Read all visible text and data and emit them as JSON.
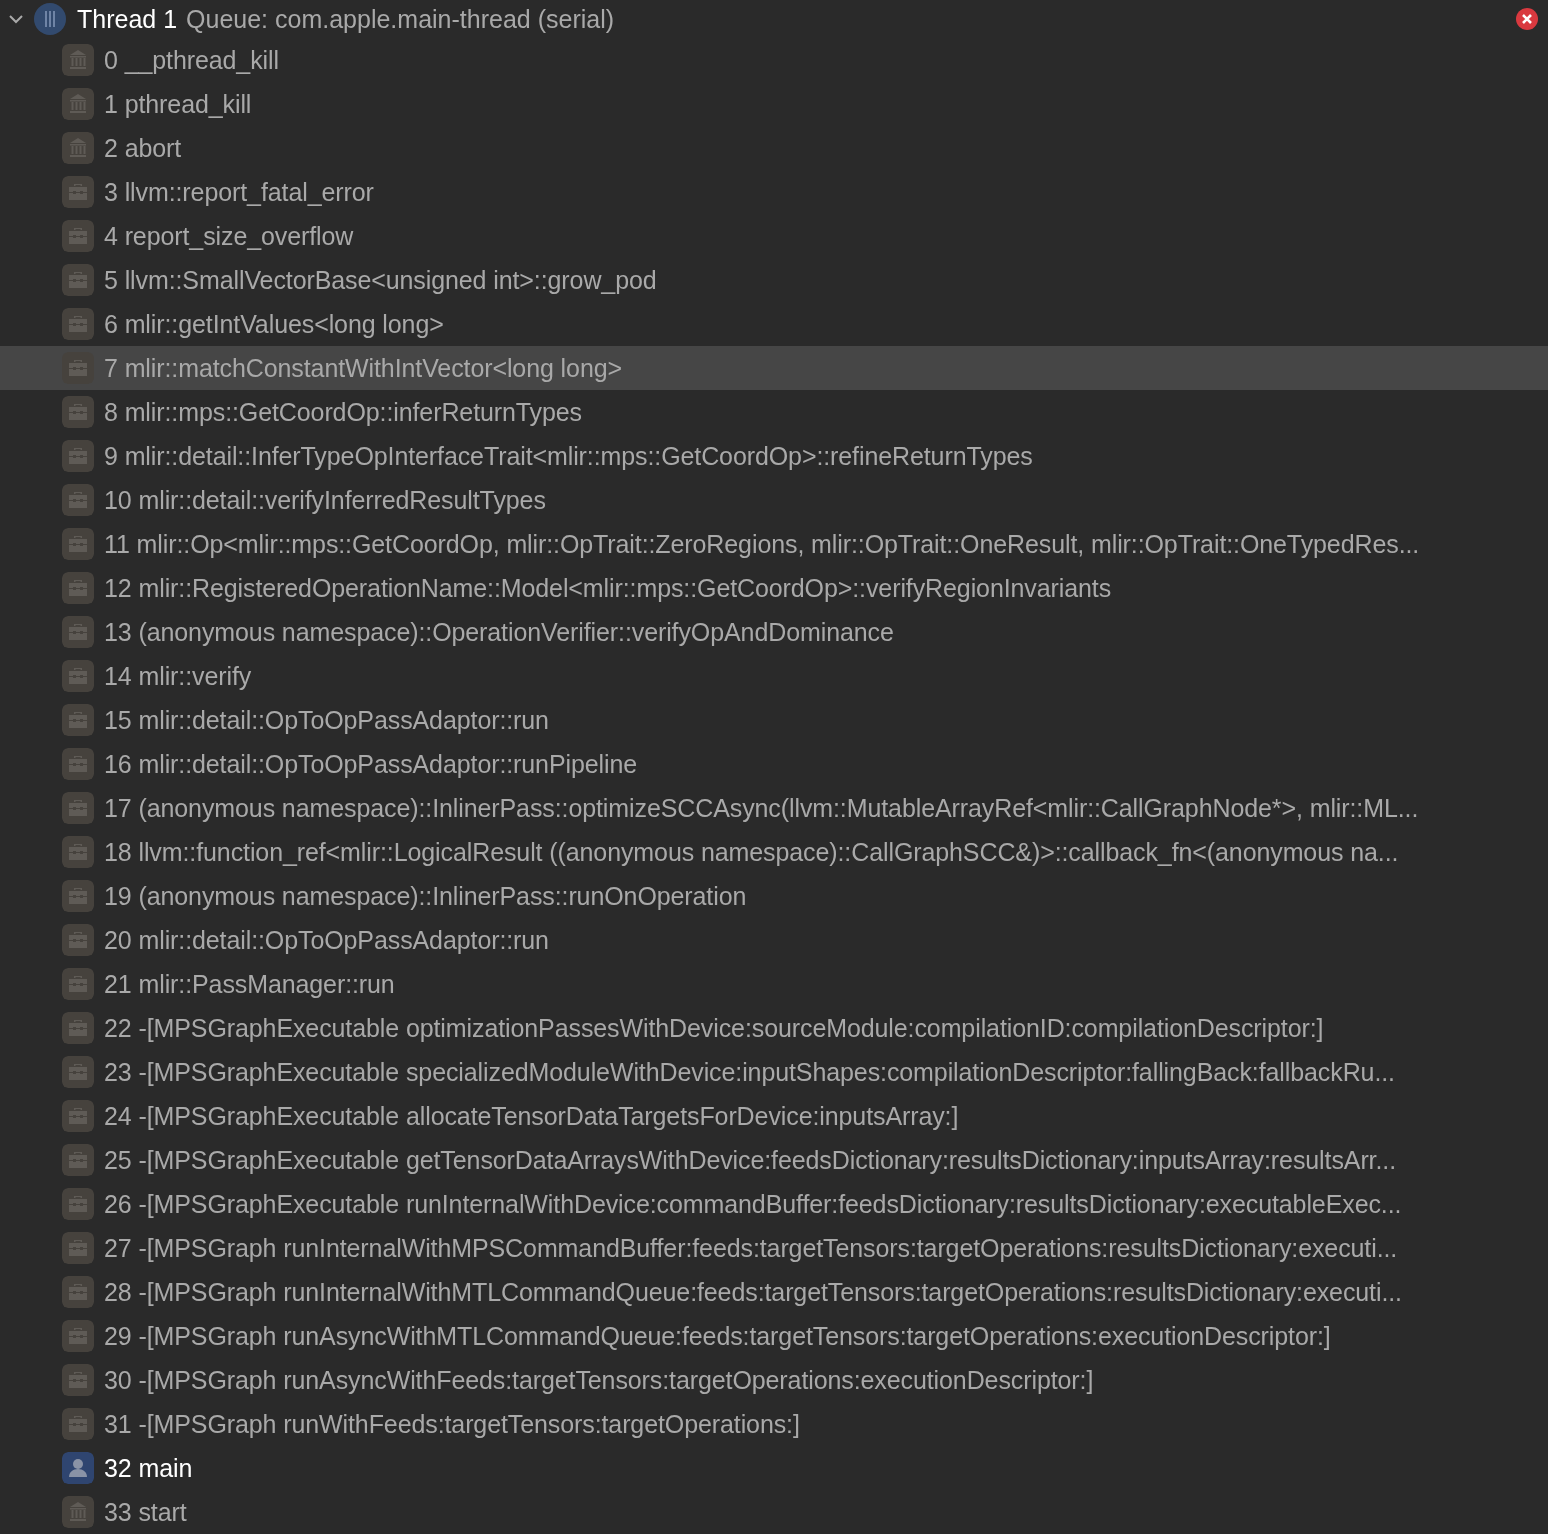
{
  "thread": {
    "title": "Thread 1",
    "queue": "Queue: com.apple.main-thread (serial)",
    "expanded": true
  },
  "frames": [
    {
      "label": "0 __pthread_kill",
      "kind": "system",
      "selected": false
    },
    {
      "label": "1 pthread_kill",
      "kind": "system",
      "selected": false
    },
    {
      "label": "2 abort",
      "kind": "system",
      "selected": false
    },
    {
      "label": "3 llvm::report_fatal_error",
      "kind": "framework",
      "selected": false
    },
    {
      "label": "4 report_size_overflow",
      "kind": "framework",
      "selected": false
    },
    {
      "label": "5 llvm::SmallVectorBase<unsigned int>::grow_pod",
      "kind": "framework",
      "selected": false
    },
    {
      "label": "6 mlir::getIntValues<long long>",
      "kind": "framework",
      "selected": false
    },
    {
      "label": "7 mlir::matchConstantWithIntVector<long long>",
      "kind": "framework",
      "selected": true
    },
    {
      "label": "8 mlir::mps::GetCoordOp::inferReturnTypes",
      "kind": "framework",
      "selected": false
    },
    {
      "label": "9 mlir::detail::InferTypeOpInterfaceTrait<mlir::mps::GetCoordOp>::refineReturnTypes",
      "kind": "framework",
      "selected": false
    },
    {
      "label": "10 mlir::detail::verifyInferredResultTypes",
      "kind": "framework",
      "selected": false
    },
    {
      "label": "11 mlir::Op<mlir::mps::GetCoordOp, mlir::OpTrait::ZeroRegions, mlir::OpTrait::OneResult, mlir::OpTrait::OneTypedRes...",
      "kind": "framework",
      "selected": false
    },
    {
      "label": "12 mlir::RegisteredOperationName::Model<mlir::mps::GetCoordOp>::verifyRegionInvariants",
      "kind": "framework",
      "selected": false
    },
    {
      "label": "13 (anonymous namespace)::OperationVerifier::verifyOpAndDominance",
      "kind": "framework",
      "selected": false
    },
    {
      "label": "14 mlir::verify",
      "kind": "framework",
      "selected": false
    },
    {
      "label": "15 mlir::detail::OpToOpPassAdaptor::run",
      "kind": "framework",
      "selected": false
    },
    {
      "label": "16 mlir::detail::OpToOpPassAdaptor::runPipeline",
      "kind": "framework",
      "selected": false
    },
    {
      "label": "17 (anonymous namespace)::InlinerPass::optimizeSCCAsync(llvm::MutableArrayRef<mlir::CallGraphNode*>, mlir::ML...",
      "kind": "framework",
      "selected": false
    },
    {
      "label": "18 llvm::function_ref<mlir::LogicalResult ((anonymous namespace)::CallGraphSCC&)>::callback_fn<(anonymous na...",
      "kind": "framework",
      "selected": false
    },
    {
      "label": "19 (anonymous namespace)::InlinerPass::runOnOperation",
      "kind": "framework",
      "selected": false
    },
    {
      "label": "20 mlir::detail::OpToOpPassAdaptor::run",
      "kind": "framework",
      "selected": false
    },
    {
      "label": "21 mlir::PassManager::run",
      "kind": "framework",
      "selected": false
    },
    {
      "label": "22 -[MPSGraphExecutable optimizationPassesWithDevice:sourceModule:compilationID:compilationDescriptor:]",
      "kind": "framework",
      "selected": false
    },
    {
      "label": "23 -[MPSGraphExecutable specializedModuleWithDevice:inputShapes:compilationDescriptor:fallingBack:fallbackRu...",
      "kind": "framework",
      "selected": false
    },
    {
      "label": "24 -[MPSGraphExecutable allocateTensorDataTargetsForDevice:inputsArray:]",
      "kind": "framework",
      "selected": false
    },
    {
      "label": "25 -[MPSGraphExecutable getTensorDataArraysWithDevice:feedsDictionary:resultsDictionary:inputsArray:resultsArr...",
      "kind": "framework",
      "selected": false
    },
    {
      "label": "26 -[MPSGraphExecutable runInternalWithDevice:commandBuffer:feedsDictionary:resultsDictionary:executableExec...",
      "kind": "framework",
      "selected": false
    },
    {
      "label": "27 -[MPSGraph runInternalWithMPSCommandBuffer:feeds:targetTensors:targetOperations:resultsDictionary:executi...",
      "kind": "framework",
      "selected": false
    },
    {
      "label": "28 -[MPSGraph runInternalWithMTLCommandQueue:feeds:targetTensors:targetOperations:resultsDictionary:executi...",
      "kind": "framework",
      "selected": false
    },
    {
      "label": "29 -[MPSGraph runAsyncWithMTLCommandQueue:feeds:targetTensors:targetOperations:executionDescriptor:]",
      "kind": "framework",
      "selected": false
    },
    {
      "label": "30 -[MPSGraph runAsyncWithFeeds:targetTensors:targetOperations:executionDescriptor:]",
      "kind": "framework",
      "selected": false
    },
    {
      "label": "31 -[MPSGraph runWithFeeds:targetTensors:targetOperations:]",
      "kind": "framework",
      "selected": false
    },
    {
      "label": "32 main",
      "kind": "user",
      "selected": false
    },
    {
      "label": "33 start",
      "kind": "system",
      "selected": false
    }
  ]
}
